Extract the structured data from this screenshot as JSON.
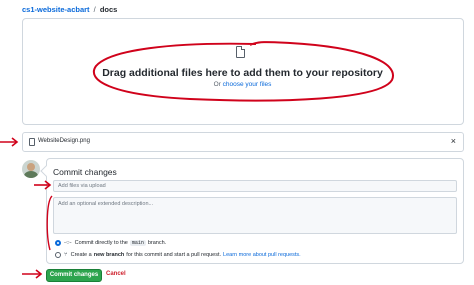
{
  "breadcrumb": {
    "repo": "cs1-website-acbart",
    "separator": "/",
    "folder": "docs"
  },
  "dropzone": {
    "icon": "file-icon",
    "title": "Drag additional files here to add them to your repository",
    "or_text": "Or",
    "choose_link": "choose your files"
  },
  "uploaded_file": {
    "name": "WebsiteDesign.png",
    "remove_glyph": "×"
  },
  "commit": {
    "title": "Commit changes",
    "summary_placeholder": "Add files via upload",
    "description_placeholder": "Add an optional extended description...",
    "option_direct": {
      "prefix": "Commit directly to the",
      "branch": "main",
      "suffix": "branch.",
      "selected": true
    },
    "option_new_branch": {
      "prefix": "Create a",
      "bold": "new branch",
      "suffix": "for this commit and start a pull request.",
      "link": "Learn more about pull requests."
    },
    "commit_button": "Commit changes",
    "cancel_button": "Cancel"
  },
  "colors": {
    "accent": "#0969da",
    "commit_green": "#2da44e",
    "cancel_red": "#cf222e",
    "annotation_red": "#d0021b"
  }
}
